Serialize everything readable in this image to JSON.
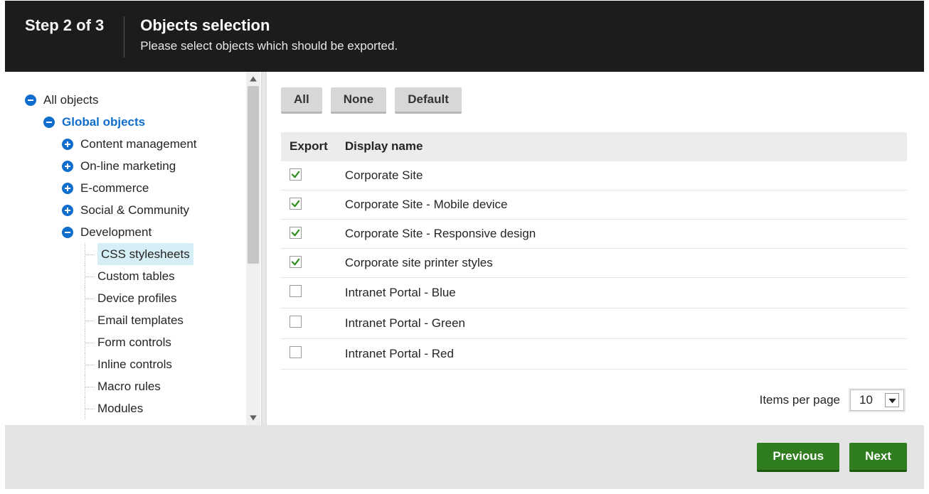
{
  "header": {
    "step": "Step 2 of 3",
    "title": "Objects selection",
    "subtitle": "Please select objects which should be exported."
  },
  "tree": {
    "root": "All objects",
    "global": "Global objects",
    "categories": [
      {
        "label": "Content management",
        "expanded": false
      },
      {
        "label": "On-line marketing",
        "expanded": false
      },
      {
        "label": "E-commerce",
        "expanded": false
      },
      {
        "label": "Social & Community",
        "expanded": false
      }
    ],
    "dev": {
      "label": "Development",
      "children": [
        "CSS stylesheets",
        "Custom tables",
        "Device profiles",
        "Email templates",
        "Form controls",
        "Inline controls",
        "Macro rules",
        "Modules"
      ],
      "selected_index": 0
    }
  },
  "toolbar": {
    "all": "All",
    "none": "None",
    "default": "Default"
  },
  "table": {
    "col_export": "Export",
    "col_name": "Display name",
    "rows": [
      {
        "name": "Corporate Site",
        "checked": true
      },
      {
        "name": "Corporate Site - Mobile device",
        "checked": true
      },
      {
        "name": "Corporate Site - Responsive design",
        "checked": true
      },
      {
        "name": "Corporate site printer styles",
        "checked": true
      },
      {
        "name": "Intranet Portal - Blue",
        "checked": false
      },
      {
        "name": "Intranet Portal - Green",
        "checked": false
      },
      {
        "name": "Intranet Portal - Red",
        "checked": false
      }
    ]
  },
  "pager": {
    "label": "Items per page",
    "value": "10"
  },
  "footer": {
    "prev": "Previous",
    "next": "Next"
  }
}
